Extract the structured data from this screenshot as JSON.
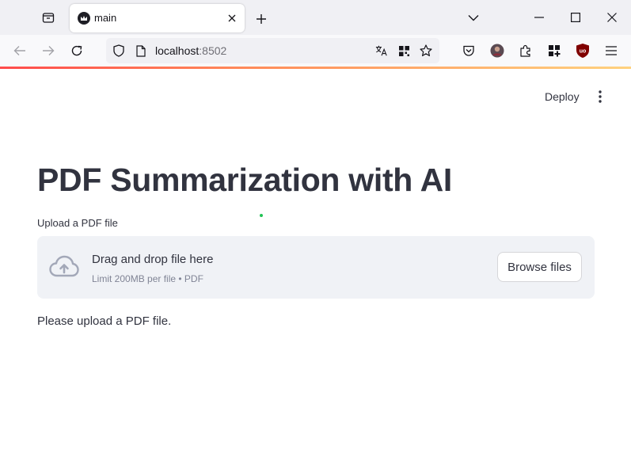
{
  "browser": {
    "tab_title": "main",
    "url_host": "localhost",
    "url_port": ":8502",
    "icons": [
      "tab-overview-icon",
      "app-favicon-icon",
      "close-icon",
      "plus-icon",
      "chevron-down-icon",
      "minimize-icon",
      "maximize-icon",
      "window-close-icon",
      "back-arrow-icon",
      "forward-arrow-icon",
      "reload-icon",
      "shield-icon",
      "page-icon",
      "translate-icon",
      "qr-icon",
      "star-icon",
      "pocket-icon",
      "profile-avatar",
      "puzzle-icon",
      "extensions-icon",
      "ublock-icon",
      "hamburger-menu-icon"
    ],
    "ublock_badge": "uo"
  },
  "header": {
    "deploy_label": "Deploy"
  },
  "main": {
    "title": "PDF Summarization with AI",
    "upload_label": "Upload a PDF file",
    "dropzone": {
      "main_text": "Drag and drop file here",
      "sub_text": "Limit 200MB per file • PDF",
      "button_label": "Browse files"
    },
    "status_message": "Please upload a PDF file."
  },
  "colors": {
    "accent": "#ff4b4b",
    "text": "#31333f",
    "dropzone_bg": "#f0f2f6"
  }
}
